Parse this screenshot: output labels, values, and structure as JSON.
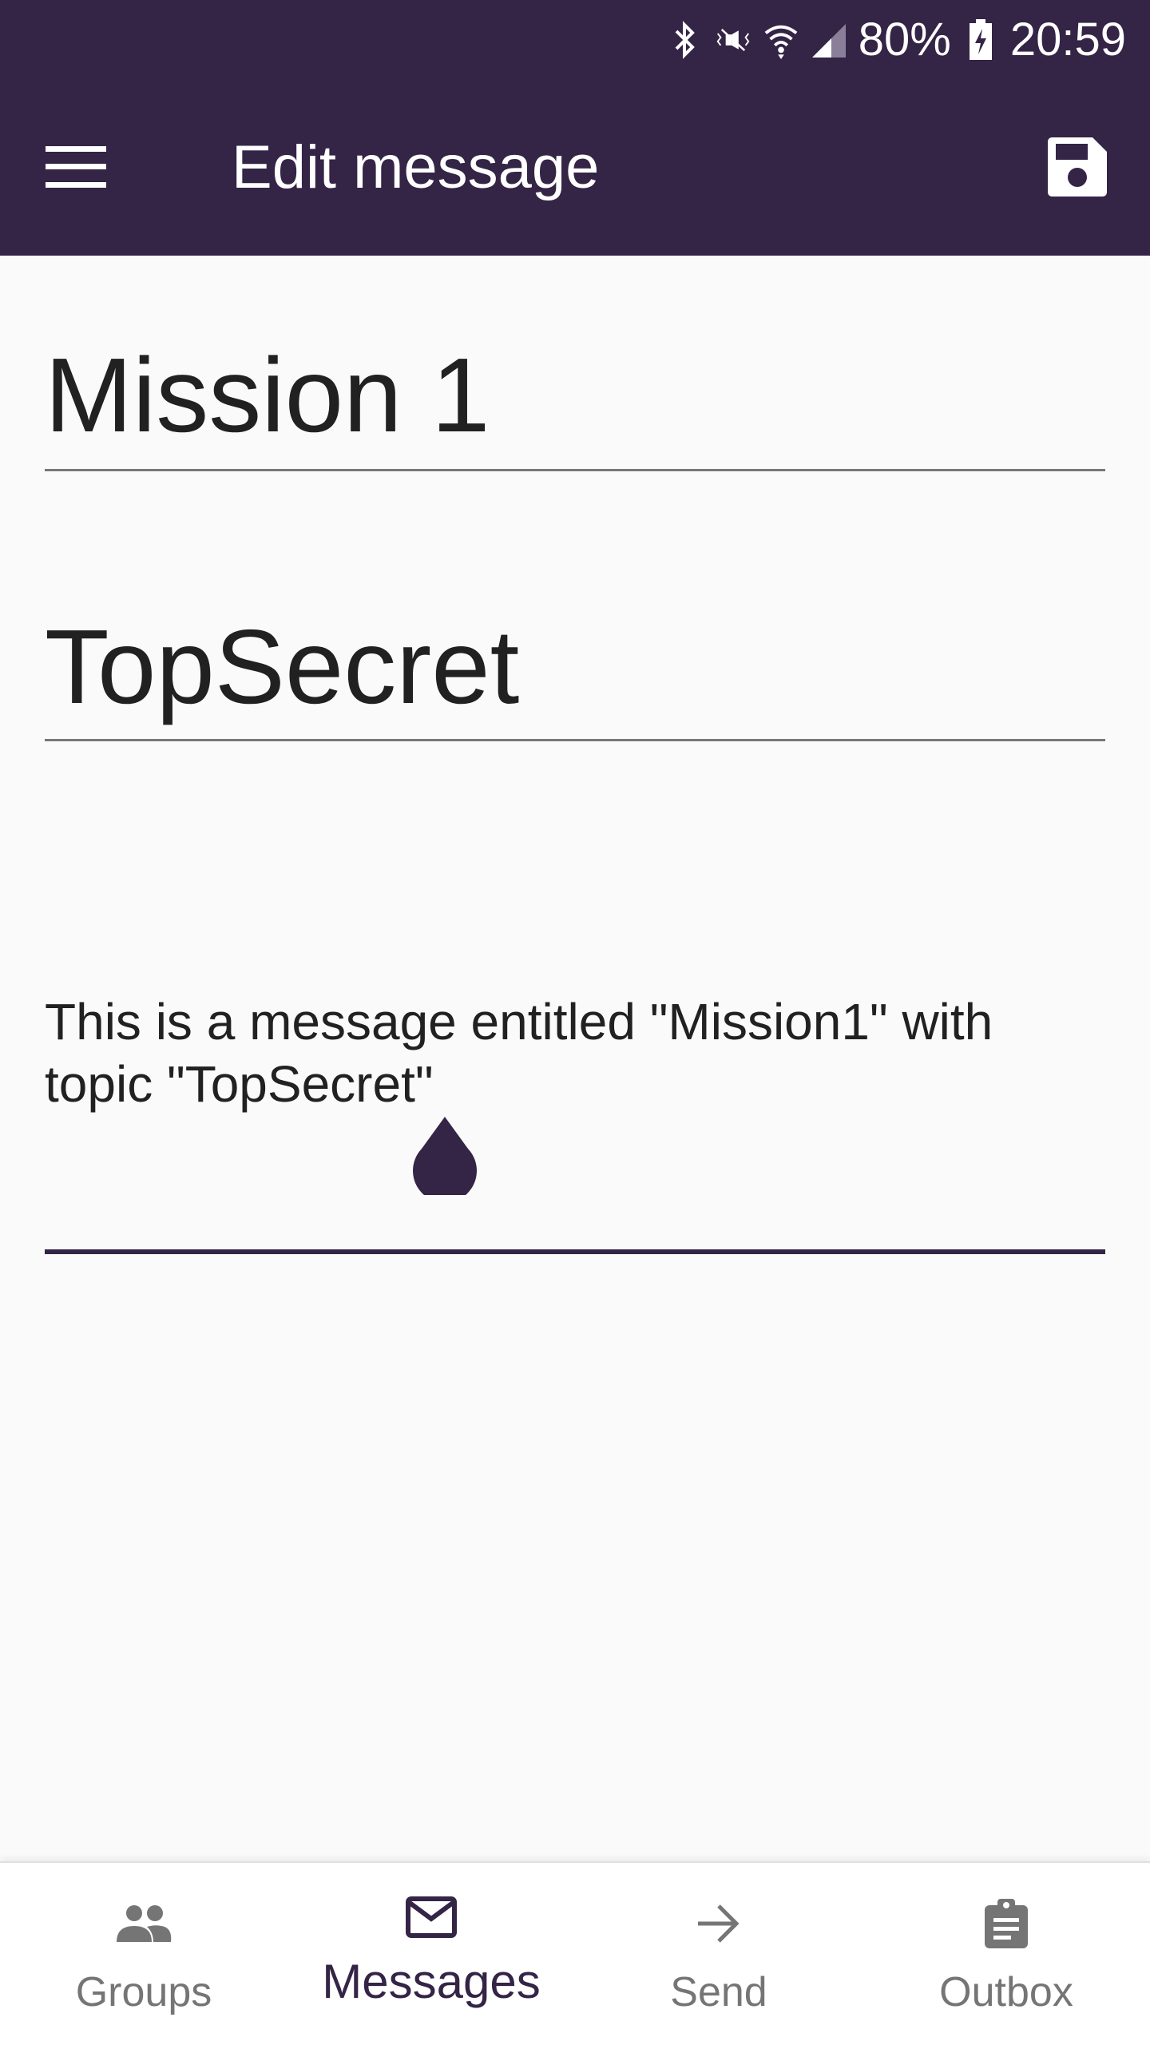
{
  "status_bar": {
    "battery_percent": "80%",
    "time": "20:59",
    "icons": [
      "bluetooth-icon",
      "vibrate-mute-icon",
      "wifi-icon",
      "cell-signal-icon",
      "battery-charging-icon"
    ]
  },
  "app_bar": {
    "title": "Edit message",
    "menu_icon": "hamburger-menu-icon",
    "save_icon": "floppy-disk-icon",
    "background_color": "#342446"
  },
  "form": {
    "title_value": "Mission 1",
    "topic_value": "TopSecret",
    "body_value": "This is a message entitled \"Mission1\" with topic \"TopSecret\""
  },
  "bottom_nav": {
    "items": [
      {
        "label": "Groups",
        "icon": "people-icon",
        "active": false
      },
      {
        "label": "Messages",
        "icon": "mail-icon",
        "active": true
      },
      {
        "label": "Send",
        "icon": "arrow-right-icon",
        "active": false
      },
      {
        "label": "Outbox",
        "icon": "clipboard-icon",
        "active": false
      }
    ],
    "active_color": "#342446",
    "inactive_color": "#757575"
  }
}
